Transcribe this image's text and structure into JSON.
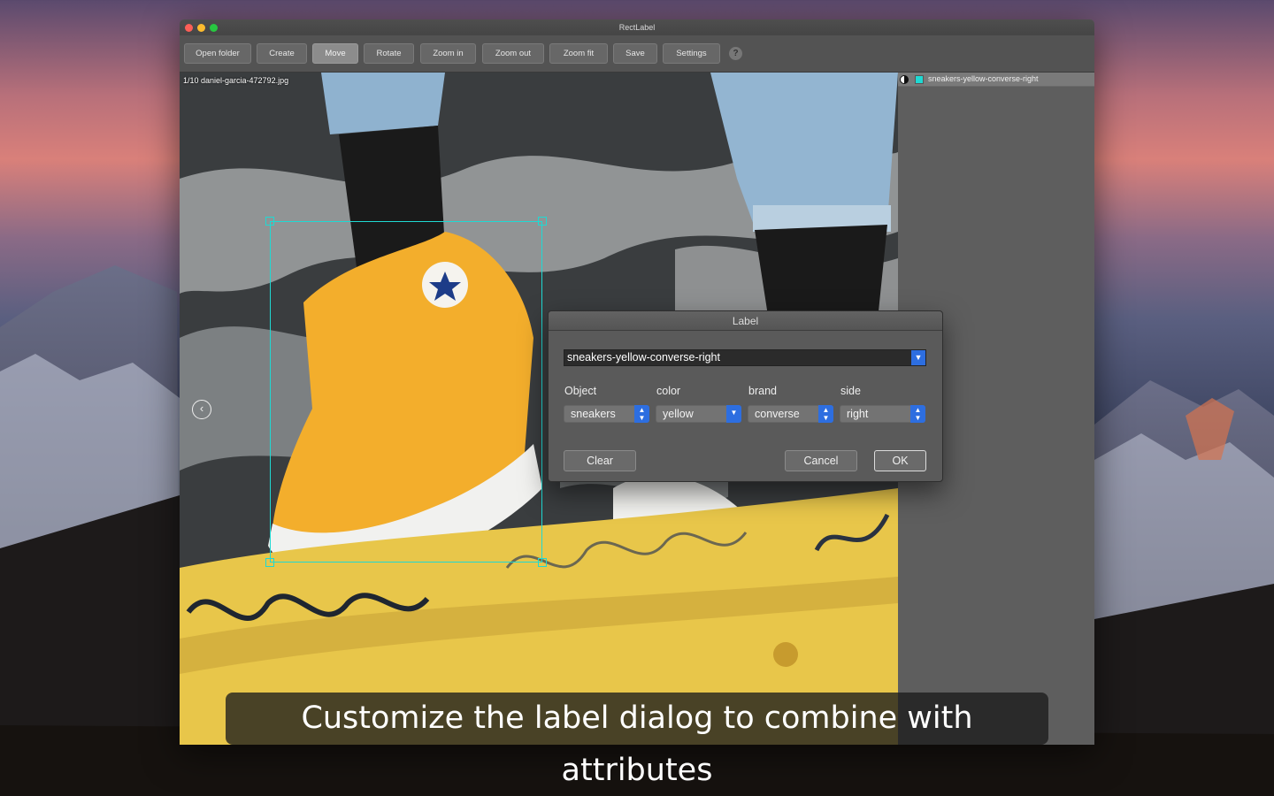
{
  "window": {
    "title": "RectLabel"
  },
  "toolbar": {
    "buttons": [
      {
        "label": "Open folder"
      },
      {
        "label": "Create"
      },
      {
        "label": "Move"
      },
      {
        "label": "Rotate"
      },
      {
        "label": "Zoom in"
      },
      {
        "label": "Zoom out"
      },
      {
        "label": "Zoom fit"
      },
      {
        "label": "Save"
      },
      {
        "label": "Settings"
      }
    ],
    "active": "Move",
    "help": "?"
  },
  "canvas": {
    "file_label": "1/10 daniel-garcia-472792.jpg"
  },
  "sidebar": {
    "label_name": "sneakers-yellow-converse-right",
    "label_color": "#1fd9d3"
  },
  "dialog": {
    "title": "Label",
    "combo_value": "sneakers-yellow-converse-right",
    "attributes": [
      {
        "name": "Object",
        "value": "sneakers"
      },
      {
        "name": "color",
        "value": "yellow"
      },
      {
        "name": "brand",
        "value": "converse"
      },
      {
        "name": "side",
        "value": "right"
      }
    ],
    "clear_label": "Clear",
    "cancel_label": "Cancel",
    "ok_label": "OK"
  },
  "caption": "Customize the label dialog to combine with attributes"
}
